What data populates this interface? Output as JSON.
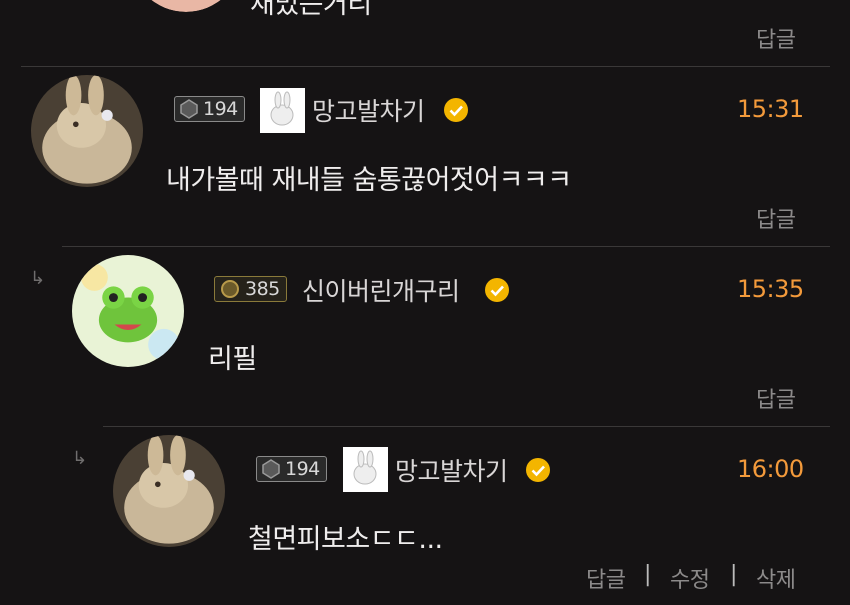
{
  "top_comment": {
    "partial_message": "재밌는거리",
    "reply_label": "답글"
  },
  "comments": [
    {
      "level": "194",
      "username": "망고발차기",
      "time": "15:31",
      "message": "내가볼때 재내들 숨통끊어젓어ㅋㅋㅋ",
      "actions": [
        "답글"
      ]
    },
    {
      "level": "385",
      "username": "신이버린개구리",
      "time": "15:35",
      "message": "리필",
      "actions": [
        "답글"
      ]
    },
    {
      "level": "194",
      "username": "망고발차기",
      "time": "16:00",
      "message": "철면피보소ㄷㄷ...",
      "actions": [
        "답글",
        "수정",
        "삭제"
      ],
      "action_separator": "|"
    }
  ],
  "icons": {
    "reply_indicator": "reply-arrow-icon",
    "verified": "verified-check-icon",
    "level_badge": "level-badge-icon"
  },
  "colors": {
    "background": "#151314",
    "time": "#f39a3b",
    "verified": "#f3b500",
    "text": "#efeded",
    "muted": "#8c8a8a"
  }
}
